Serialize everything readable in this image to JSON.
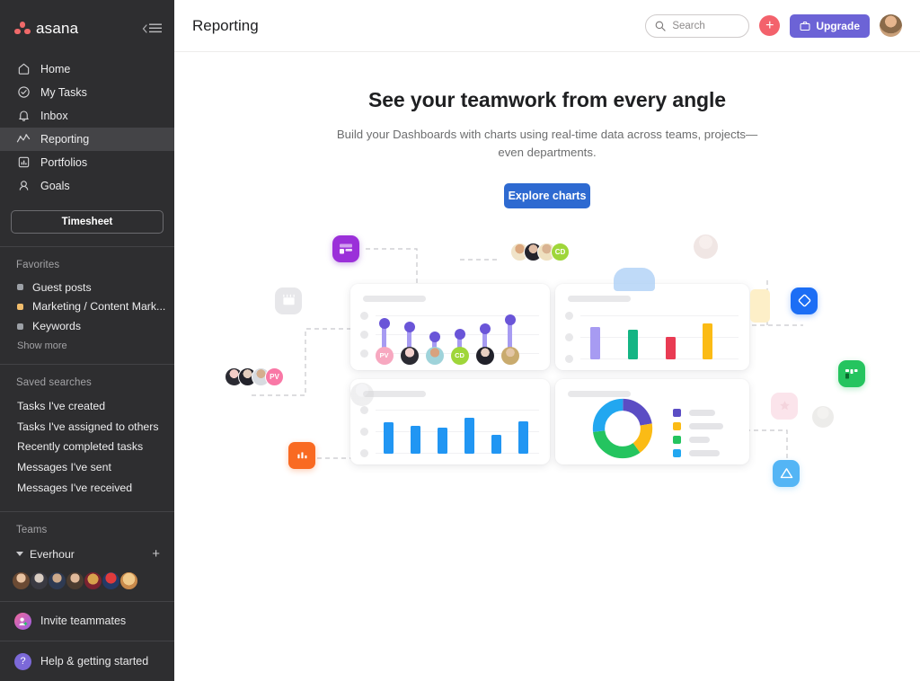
{
  "sidebar": {
    "logo_text": "asana",
    "collapse_icon": "collapse-sidebar-icon",
    "nav": [
      {
        "label": "Home",
        "icon": "home-icon",
        "active": false
      },
      {
        "label": "My Tasks",
        "icon": "check-circle-icon",
        "active": false
      },
      {
        "label": "Inbox",
        "icon": "bell-icon",
        "active": false
      },
      {
        "label": "Reporting",
        "icon": "line-chart-icon",
        "active": true
      },
      {
        "label": "Portfolios",
        "icon": "portfolio-icon",
        "active": false
      },
      {
        "label": "Goals",
        "icon": "goal-icon",
        "active": false
      }
    ],
    "timesheet_label": "Timesheet",
    "favorites_title": "Favorites",
    "favorites": [
      {
        "label": "Guest posts",
        "color": "#9ca0a6"
      },
      {
        "label": "Marketing / Content Mark...",
        "color": "#f1bd6c"
      },
      {
        "label": "Keywords",
        "color": "#9ca0a6"
      }
    ],
    "show_more": "Show more",
    "saved_searches_title": "Saved searches",
    "saved_searches": [
      "Tasks I've created",
      "Tasks I've assigned to others",
      "Recently completed tasks",
      "Messages I've sent",
      "Messages I've received"
    ],
    "teams_title": "Teams",
    "team_name": "Everhour",
    "team_add_label": "+",
    "team_member_count": 7,
    "invite_label": "Invite teammates",
    "help_label": "Help & getting started"
  },
  "header": {
    "title": "Reporting",
    "search_placeholder": "Search",
    "search_value": "",
    "add_button_label": "+",
    "upgrade_label": "Upgrade",
    "avatar_name": "user-avatar"
  },
  "hero": {
    "heading": "See your teamwork from every angle",
    "subheading": "Build your Dashboards with charts using real-time data across teams, projects—even departments.",
    "cta_label": "Explore charts"
  },
  "colors": {
    "brand_coral": "#f06a6a",
    "sidebar_bg": "#2e2e30",
    "upgrade_purple": "#6c63d6",
    "cta_blue": "#2e6ad1",
    "plus_red": "#f3626c"
  },
  "illustration": {
    "cards": [
      {
        "name": "lollipop-chart-card",
        "chart_type": "lollipop",
        "values": [
          74,
          66,
          46,
          50,
          60,
          86
        ],
        "stem_color": "#a79bf2",
        "head_color": "#6a55d8",
        "avatars": [
          {
            "type": "initials",
            "text": "PV",
            "color": "#f7a8c0"
          },
          {
            "type": "photo",
            "text": ""
          },
          {
            "type": "photo",
            "text": ""
          },
          {
            "type": "initials",
            "text": "CD",
            "color": "#9fd63a"
          },
          {
            "type": "photo",
            "text": ""
          },
          {
            "type": "photo",
            "text": ""
          }
        ]
      },
      {
        "name": "column-chart-card",
        "chart_type": "bar",
        "values": [
          62,
          55,
          38,
          70
        ],
        "bar_colors": [
          "#a79bf2",
          "#14b584",
          "#e93b53",
          "#fbbb15"
        ]
      },
      {
        "name": "blue-bar-chart-card",
        "chart_type": "bar",
        "values": [
          62,
          52,
          48,
          74,
          33,
          66
        ],
        "bar_colors": [
          "#2196f3",
          "#2196f3",
          "#2196f3",
          "#2196f3",
          "#2196f3",
          "#2196f3"
        ]
      },
      {
        "name": "donut-chart-card",
        "chart_type": "pie",
        "values": [
          22,
          18,
          33,
          27
        ],
        "slice_colors": [
          "#5b4dc4",
          "#fbbb15",
          "#24c45f",
          "#22a7f0"
        ],
        "legend_items": 4
      }
    ],
    "floating": [
      {
        "name": "purple-list-icon",
        "color": "#9b30d9"
      },
      {
        "name": "calendar-icon",
        "color": "#e7e7ea"
      },
      {
        "name": "blue-diamond-icon",
        "color": "#1c6ef5"
      },
      {
        "name": "green-board-icon",
        "color": "#25c45f"
      },
      {
        "name": "pink-star-icon",
        "color": "#fbe0e8"
      },
      {
        "name": "blue-triangle-icon",
        "color": "#54b5f5"
      },
      {
        "name": "orange-folder-chart-icon",
        "color": "#f96a22"
      }
    ],
    "avatar_groups": [
      {
        "name": "avatar-stack-cd",
        "badge": "CD",
        "badge_color": "#9fd63a",
        "count": 4
      },
      {
        "name": "avatar-stack-pv",
        "badge": "PV",
        "badge_color": "#f978a6",
        "count": 4
      }
    ]
  }
}
